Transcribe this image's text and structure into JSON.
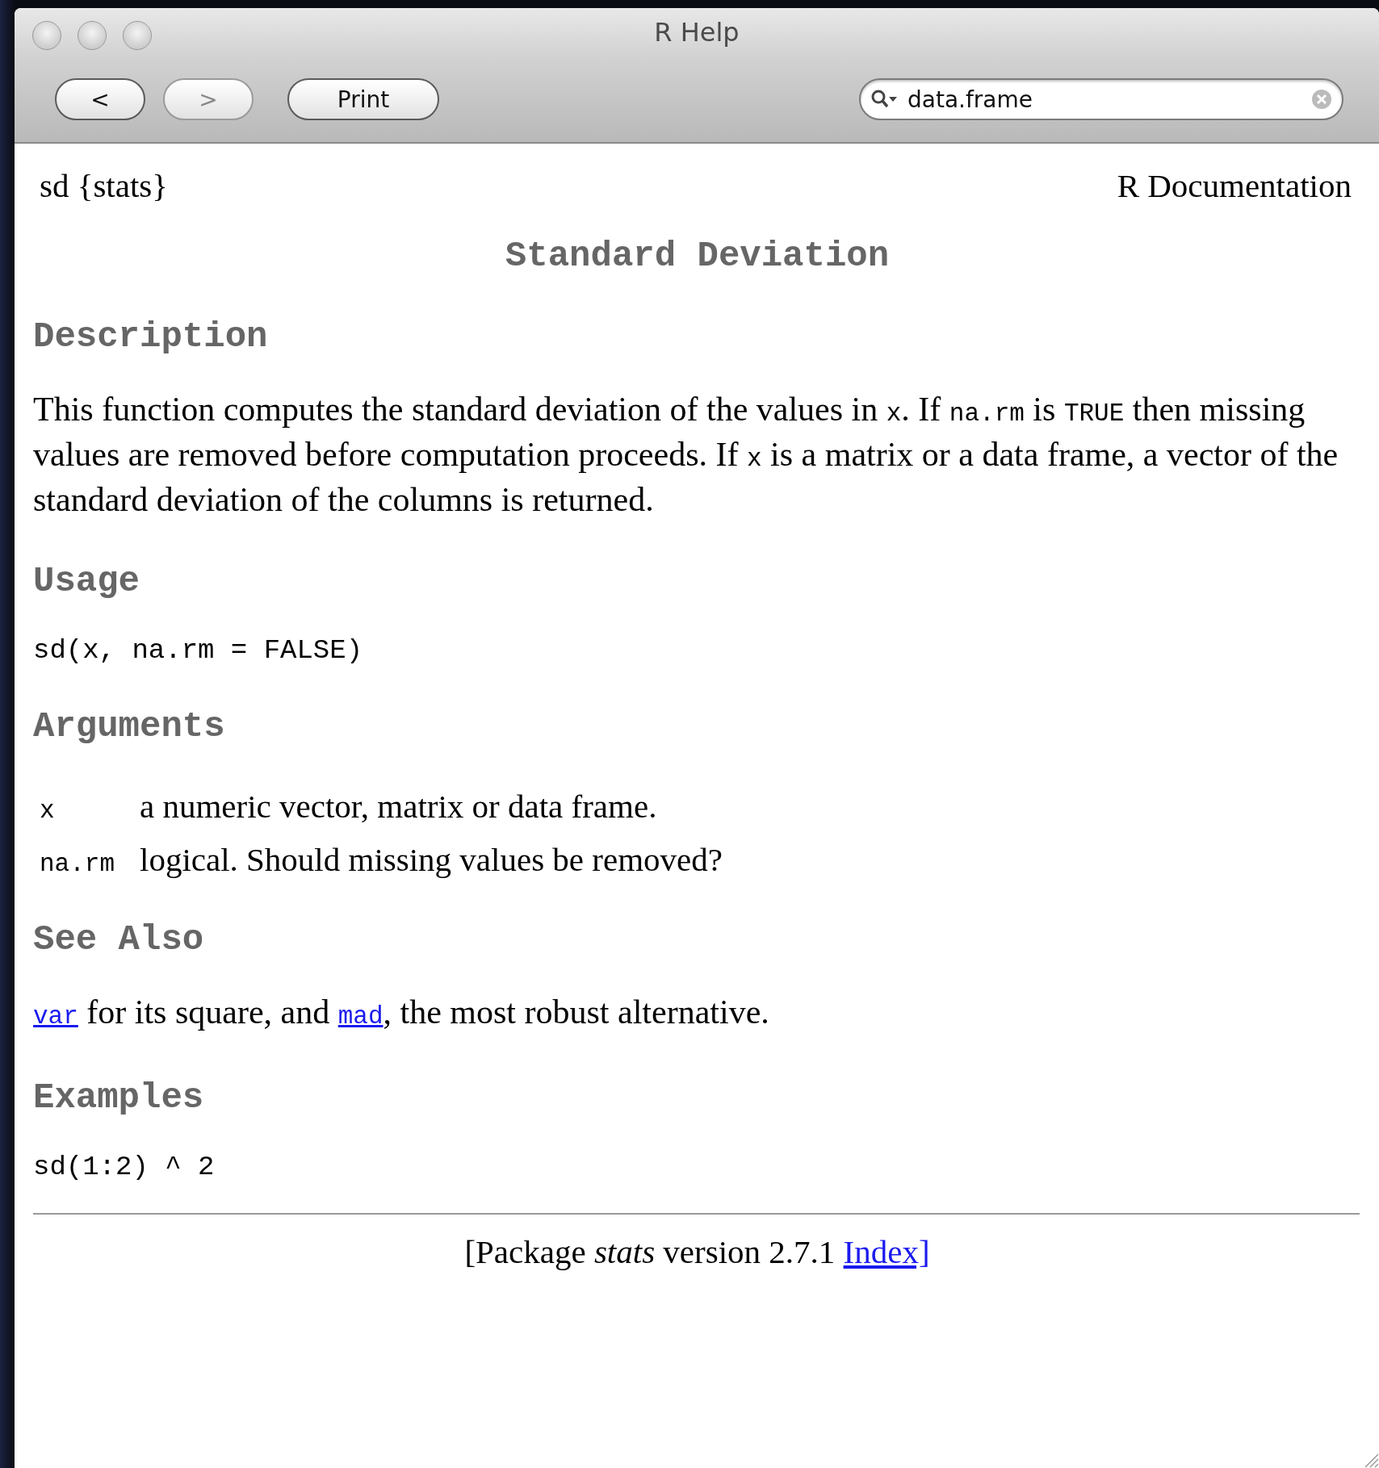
{
  "window": {
    "title": "R Help"
  },
  "toolbar": {
    "buttons": [
      {
        "kind": "back",
        "label": "<",
        "disabled": false
      },
      {
        "kind": "forward",
        "label": ">",
        "disabled": true
      },
      {
        "kind": "print",
        "label": "Print",
        "disabled": false
      }
    ],
    "search": {
      "value": "data.frame"
    }
  },
  "page": {
    "topic": "sd {stats}",
    "doc_label": "R Documentation",
    "title": "Standard Deviation",
    "sections": [
      {
        "kind": "paragraph",
        "heading": "Description",
        "segments": [
          {
            "kind": "text",
            "text": "This function computes the standard deviation of the values in "
          },
          {
            "kind": "code",
            "text": "x"
          },
          {
            "kind": "text",
            "text": ". If "
          },
          {
            "kind": "code",
            "text": "na.rm"
          },
          {
            "kind": "text",
            "text": " is "
          },
          {
            "kind": "code",
            "text": "TRUE"
          },
          {
            "kind": "text",
            "text": " then missing values are removed before computation proceeds. If "
          },
          {
            "kind": "code",
            "text": "x"
          },
          {
            "kind": "text",
            "text": " is a matrix or a data frame, a vector of the standard deviation of the columns is returned."
          }
        ]
      },
      {
        "kind": "code",
        "heading": "Usage",
        "code": "sd(x, na.rm = FALSE)"
      },
      {
        "kind": "arguments",
        "heading": "Arguments",
        "items": [
          {
            "name": "x",
            "desc": "a numeric vector, matrix or data frame."
          },
          {
            "name": "na.rm",
            "desc": "logical. Should missing values be removed?"
          }
        ]
      },
      {
        "kind": "paragraph",
        "heading": "See Also",
        "segments": [
          {
            "kind": "code-link",
            "text": "var"
          },
          {
            "kind": "text",
            "text": " for its square, and "
          },
          {
            "kind": "code-link",
            "text": "mad"
          },
          {
            "kind": "text",
            "text": ", the most robust alternative."
          }
        ]
      },
      {
        "kind": "code",
        "heading": "Examples",
        "code": "sd(1:2) ^ 2"
      }
    ],
    "footer": {
      "segments": [
        {
          "kind": "text",
          "text": "[Package "
        },
        {
          "kind": "italic",
          "text": "stats"
        },
        {
          "kind": "text",
          "text": " version 2.7.1 "
        },
        {
          "kind": "link",
          "text": "Index]"
        }
      ]
    }
  }
}
